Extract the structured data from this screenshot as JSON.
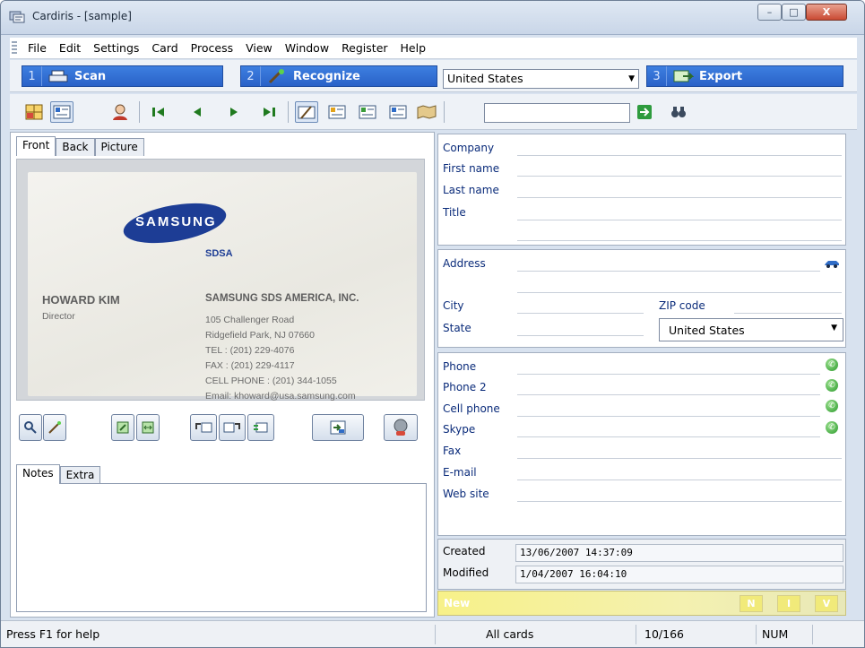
{
  "window": {
    "title": "Cardiris - [sample]",
    "min_label": "–",
    "max_label": "□",
    "close_label": "X"
  },
  "menu": [
    "File",
    "Edit",
    "Settings",
    "Card",
    "Process",
    "View",
    "Window",
    "Register",
    "Help"
  ],
  "steps": {
    "scan": {
      "num": "1",
      "label": "Scan"
    },
    "recognize": {
      "num": "2",
      "label": "Recognize"
    },
    "country": "United States",
    "export": {
      "num": "3",
      "label": "Export"
    }
  },
  "card_tabs": [
    "Front",
    "Back",
    "Picture"
  ],
  "card": {
    "logo": "SAMSUNG",
    "logo_sub": "SDSA",
    "name": "HOWARD KIM",
    "job_title": "Director",
    "company": "SAMSUNG SDS AMERICA, INC.",
    "lines": [
      "105 Challenger Road",
      "Ridgefield Park, NJ 07660",
      "TEL  : (201) 229-4076",
      "FAX  : (201) 229-4117",
      "CELL PHONE : (201) 344-1055",
      "Email: khoward@usa.samsung.com"
    ]
  },
  "notes_tabs": [
    "Notes",
    "Extra"
  ],
  "fields": {
    "company": "Company",
    "first_name": "First name",
    "last_name": "Last name",
    "title": "Title",
    "address": "Address",
    "city": "City",
    "zip": "ZIP code",
    "state": "State",
    "state_country": "United States",
    "phone": "Phone",
    "phone2": "Phone 2",
    "cell": "Cell phone",
    "skype": "Skype",
    "fax": "Fax",
    "email": "E-mail",
    "web": "Web site"
  },
  "dates": {
    "created_label": "Created",
    "created": "13/06/2007 14:37:09",
    "modified_label": "Modified",
    "modified": "1/04/2007 16:04:10"
  },
  "newbar": {
    "label": "New",
    "btns": [
      "N",
      "I",
      "V"
    ]
  },
  "status": {
    "help": "Press F1 for help",
    "filter": "All cards",
    "count": "10/166",
    "num": "NUM"
  }
}
